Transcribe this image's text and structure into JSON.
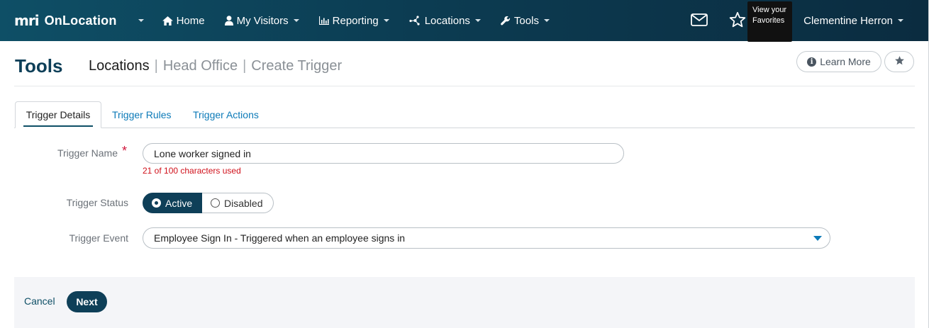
{
  "header": {
    "brand_logo": "mri",
    "brand_name": "OnLocation",
    "nav": [
      {
        "label": "Home",
        "icon": "home-icon"
      },
      {
        "label": "My Visitors",
        "icon": "user-icon"
      },
      {
        "label": "Reporting",
        "icon": "bar-chart-icon"
      },
      {
        "label": "Locations",
        "icon": "network-icon"
      },
      {
        "label": "Tools",
        "icon": "wrench-icon"
      }
    ],
    "mail_icon": "mail-icon",
    "favorites_icon": "star-outline-icon",
    "tooltip": "View your Favorites",
    "user_name": "Clementine Herron"
  },
  "page": {
    "title": "Tools",
    "breadcrumb": {
      "main": "Locations",
      "sep": "|",
      "items": [
        "Head Office",
        "Create Trigger"
      ]
    },
    "learn_more": "Learn More",
    "favorite_icon": "star-icon"
  },
  "tabs": [
    {
      "label": "Trigger Details",
      "active": true
    },
    {
      "label": "Trigger Rules",
      "active": false
    },
    {
      "label": "Trigger Actions",
      "active": false
    }
  ],
  "form": {
    "trigger_name": {
      "label": "Trigger Name",
      "required_mark": "*",
      "value": "Lone worker signed in",
      "helper": "21 of 100 characters used"
    },
    "trigger_status": {
      "label": "Trigger Status",
      "options": [
        "Active",
        "Disabled"
      ],
      "selected": "Active"
    },
    "trigger_event": {
      "label": "Trigger Event",
      "value": "Employee Sign In - Triggered when an employee signs in"
    }
  },
  "footer": {
    "cancel": "Cancel",
    "next": "Next"
  },
  "colors": {
    "header_bg": "#0c3c52",
    "primary": "#0e3f58",
    "link": "#0c7ab8",
    "error": "#d0101a",
    "brand_accent": "#8cc63e"
  }
}
